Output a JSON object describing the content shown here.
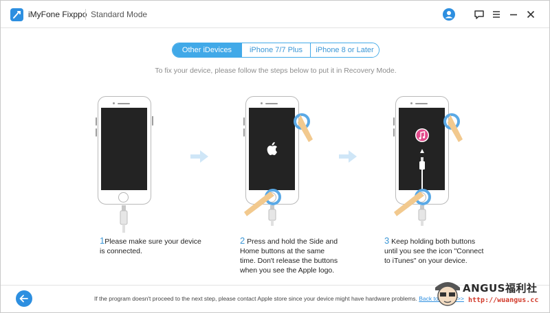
{
  "app": {
    "name": "iMyFone Fixppo",
    "mode": "Standard Mode"
  },
  "titlebar_icons": [
    "user-icon",
    "feedback-icon",
    "menu-icon",
    "minimize-icon",
    "close-icon"
  ],
  "tabs": [
    {
      "label": "Other iDevices",
      "active": true
    },
    {
      "label": "iPhone 7/7 Plus",
      "active": false
    },
    {
      "label": "iPhone 8 or Later",
      "active": false
    }
  ],
  "instruction": "To fix your device, please follow the steps below to put it in Recovery Mode.",
  "steps": [
    {
      "number": "1",
      "text": "Please make sure your device is connected."
    },
    {
      "number": "2",
      "text": "Press and hold the Side and Home buttons at the same time. Don't release the buttons when you see the Apple logo."
    },
    {
      "number": "3",
      "text": "Keep holding both buttons until you see the icon \"Connect to iTunes\" on your device."
    }
  ],
  "footer": {
    "message": "If the program doesn't proceed to the next step, please contact Apple store since your device might have hardware problems.",
    "link": "Back to Home >>"
  },
  "watermark": {
    "title": "ANGUS福利社",
    "url": "http://wuangus.cc"
  },
  "colors": {
    "accent": "#41a9e8",
    "brand_blue": "#2d8fe0",
    "finger": "#f2c98e",
    "press_ring": "#5aa9e6"
  }
}
